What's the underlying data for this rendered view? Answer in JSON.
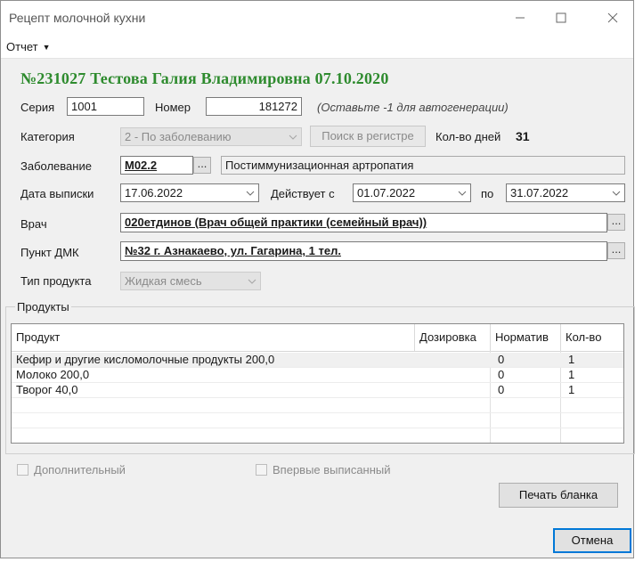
{
  "window": {
    "title": "Рецепт молочной кухни",
    "controls": {
      "minimize": "minimize-icon",
      "maximize": "maximize-icon",
      "close": "close-icon"
    }
  },
  "menu": {
    "report_label": "Отчет"
  },
  "header": {
    "line": "№231027 Тестова Галия Владимировна 07.10.2020",
    "color": "#2e8b2e"
  },
  "form": {
    "series_label": "Серия",
    "series_value": "1001",
    "number_label": "Номер",
    "number_value": "181272",
    "number_hint": "(Оставьте -1 для автогенерации)",
    "category_label": "Категория",
    "category_value": "2 - По заболеванию",
    "registry_search_label": "Поиск в регистре",
    "days_label": "Кол-во дней",
    "days_value": "31",
    "disease_label": "Заболевание",
    "disease_code": "M02.2",
    "disease_name": "Постиммунизационная артропатия",
    "issue_date_label": "Дата выписки",
    "issue_date_value": "17.06.2022",
    "valid_from_label": "Действует с",
    "valid_from_value": "01.07.2022",
    "valid_to_label": "по",
    "valid_to_value": "31.07.2022",
    "doctor_label": "Врач",
    "doctor_value": "020етдинов  (Врач общей практики (семейный врач))",
    "dmk_label": "Пункт ДМК",
    "dmk_value": "№32 г. Азнакаево, ул. Гагарина, 1 тел.",
    "product_type_label": "Тип продукта",
    "product_type_value": "Жидкая смесь",
    "dots_label": "..."
  },
  "products": {
    "group_title": "Продукты",
    "columns": [
      "Продукт",
      "Дозировка",
      "Норматив",
      "Кол-во"
    ],
    "rows": [
      {
        "product": "Кефир и другие кисломолочные продукты 200,0",
        "dosage": "",
        "norm": "0",
        "qty": "1"
      },
      {
        "product": "Молоко 200,0",
        "dosage": "",
        "norm": "0",
        "qty": "1"
      },
      {
        "product": "Творог 40,0",
        "dosage": "",
        "norm": "0",
        "qty": "1"
      }
    ]
  },
  "options": {
    "additional_label": "Дополнительный",
    "first_time_label": "Впервые выписанный"
  },
  "actions": {
    "print_label": "Печать бланка",
    "cancel_label": "Отмена",
    "accent": "#0078d7"
  }
}
